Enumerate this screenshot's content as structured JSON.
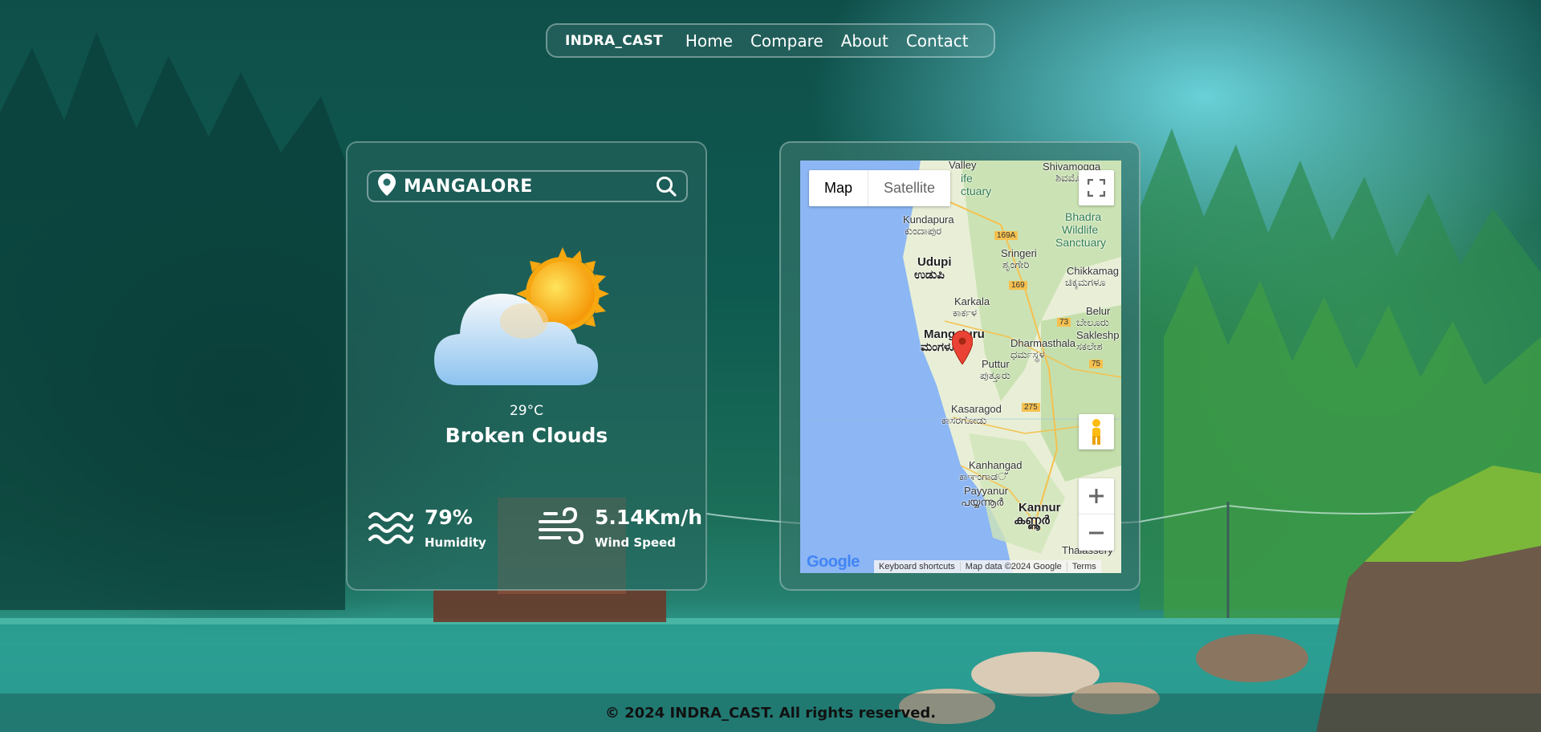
{
  "nav": {
    "brand": "INDRA_CAST",
    "links": [
      "Home",
      "Compare",
      "About",
      "Contact"
    ]
  },
  "weather": {
    "city": "MANGALORE",
    "temperature": "29°C",
    "description": "Broken Clouds",
    "humidity_value": "79%",
    "humidity_label": "Humidity",
    "wind_value": "5.14Km/h",
    "wind_label": "Wind Speed"
  },
  "map": {
    "type_map": "Map",
    "type_satellite": "Satellite",
    "google": "Google",
    "keyboard_shortcuts": "Keyboard shortcuts",
    "map_data": "Map data ©2024 Google",
    "terms": "Terms",
    "places": {
      "valley": "Valley",
      "life": "ife",
      "ctuary": "ctuary",
      "shivamogga": "Shivamogga",
      "shivamogga_kn": "ಶಿವಮೊ",
      "kundapura": "Kundapura",
      "kundapura_kn": "ಕುಂದಾಪುರ",
      "bhadra": "Bhadra",
      "wildlife": "Wildlife",
      "sanctuary": "Sanctuary",
      "r169a": "169A",
      "sringeri": "Sringeri",
      "sringeri_kn": "ಶೃಂಗೇರಿ",
      "udupi": "Udupi",
      "udupi_kn": "ಉಡುಪಿ",
      "chikkamag": "Chikkamag",
      "chikkamag_kn": "ಚಿಕ್ಕಮಗಳೂ",
      "r169": "169",
      "karkala": "Karkala",
      "karkala_kn": "ಕಾರ್ಕಳ",
      "belur": "Belur",
      "belur_kn": "ಬೇಲೂರು",
      "r73": "73",
      "sakleshp": "Sakleshp",
      "sakleshp_kn": "ಸಕಲೇಶ",
      "mangaluru": "Mangaluru",
      "mangaluru_kn": "ಮಂಗಳೂರು",
      "dharmasthala": "Dharmasthala",
      "dharmasthala_kn": "ಧರ್ಮಸ್ಥಳ",
      "puttur": "Puttur",
      "puttur_kn": "ಪುತ್ತೂರು",
      "r75": "75",
      "kasaragod": "Kasaragod",
      "kasaragod_kn": "ಕಾಸರಗೋಡು",
      "r275": "275",
      "kanhangad": "Kanhangad",
      "kanhangad_kn": "ಕಾಞಂಗಾಡ്",
      "payyanur": "Payyanur",
      "payyanur_kn": "പയ്യന്നൂർ",
      "kannur": "Kannur",
      "kannur_kn": "കണ്ണൂർ",
      "thalassery": "Thalassery"
    }
  },
  "footer": {
    "text": "© 2024 INDRA_CAST. All rights reserved."
  }
}
